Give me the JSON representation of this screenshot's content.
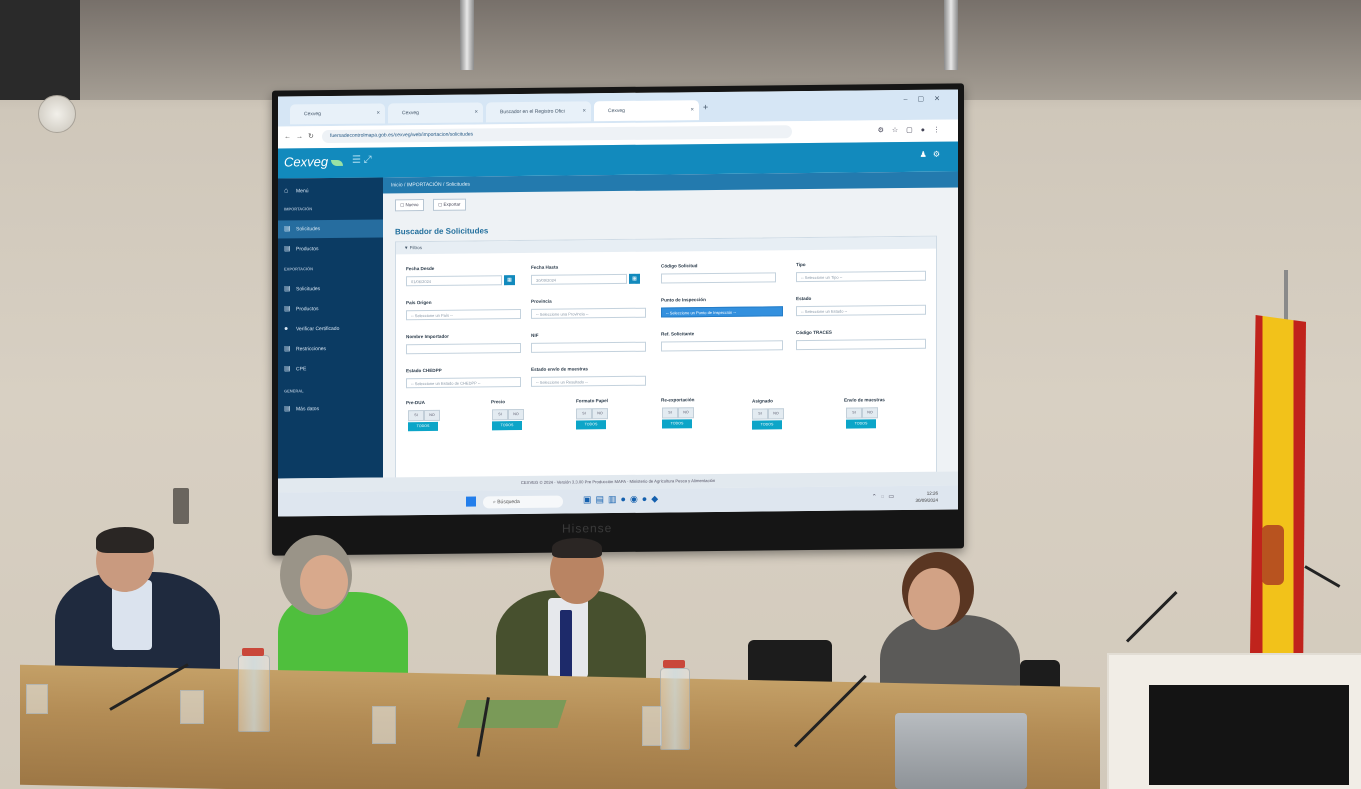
{
  "browser": {
    "tabs": [
      "Cexveg",
      "Cexveg",
      "Buscador en el Registro Ofici",
      "Cexveg"
    ],
    "url": "fuersadecontrolmapa.gob.es/cexveg/web/importacion/solicitudes",
    "tab_add": "+"
  },
  "app": {
    "logo": "Cexveg",
    "breadcrumb": "Inicio / IMPORTACIÓN / Solicitudes",
    "toolbar": {
      "new_label": "Nuevo",
      "export_label": "Exportar"
    },
    "page_title": "Buscador de Solicitudes",
    "filter_header": "Filtros"
  },
  "sidebar": {
    "menu": "Menú",
    "import_section": "IMPORTACIÓN",
    "export_section": "EXPORTACIÓN",
    "general_section": "GENERAL",
    "items": [
      {
        "label": "Solicitudes"
      },
      {
        "label": "Productos"
      },
      {
        "label": "Solicitudes"
      },
      {
        "label": "Productos"
      },
      {
        "label": "Verificar Certificado"
      },
      {
        "label": "Restricciones"
      },
      {
        "label": "CPE"
      },
      {
        "label": "Más datos"
      }
    ]
  },
  "filters": {
    "fecha_desde": {
      "label": "Fecha Desde",
      "value": "01/06/2024"
    },
    "fecha_hasta": {
      "label": "Fecha Hasta",
      "value": "30/09/2024"
    },
    "codigo_solicitud": {
      "label": "Código Solicitud",
      "value": ""
    },
    "tipo": {
      "label": "Tipo",
      "value": "-- Seleccione un Tipo --"
    },
    "pais_origen": {
      "label": "País Origen",
      "value": "-- Seleccione un País --"
    },
    "provincia": {
      "label": "Provincia",
      "value": "-- Seleccione una Provincia --"
    },
    "punto_inspeccion": {
      "label": "Punto de Inspección",
      "value": "-- Seleccione un Punto de Inspección --"
    },
    "estado": {
      "label": "Estado",
      "value": "-- Seleccione un Estado --"
    },
    "nombre_importador": {
      "label": "Nombre Importador",
      "value": ""
    },
    "nif": {
      "label": "NIF",
      "value": ""
    },
    "ref_solicitante": {
      "label": "Ref. Solicitante",
      "value": ""
    },
    "codigo_traces": {
      "label": "Código TRACES",
      "value": ""
    },
    "estado_chedpp": {
      "label": "Estado CHEDPP",
      "value": "-- Seleccione un Estado de CHEDPP --"
    },
    "estado_envio": {
      "label": "Estado envío de muestras",
      "value": "-- Seleccione un Resultado --"
    },
    "toggles": [
      {
        "label": "Pre-DUA"
      },
      {
        "label": "Precio"
      },
      {
        "label": "Formato Papel"
      },
      {
        "label": "Re-exportación"
      },
      {
        "label": "Asignado"
      },
      {
        "label": "Envío de muestras"
      }
    ],
    "si": "SI",
    "no": "NO",
    "todos": "TODOS"
  },
  "footer": "CEXVEG © 2024 - Versión 3.3.00 Pre Producción    MAPA - Ministerio de Agricultura Pesca y Alimentación",
  "taskbar": {
    "search": "Búsqueda",
    "time": "12:26",
    "date": "30/09/2024"
  },
  "tv_brand": "Hisense",
  "colors": {
    "app_bar": "#1b88b6",
    "sidebar": "#0f3a5f",
    "accent": "#17a2c2",
    "highlight": "#3a8fd6"
  }
}
